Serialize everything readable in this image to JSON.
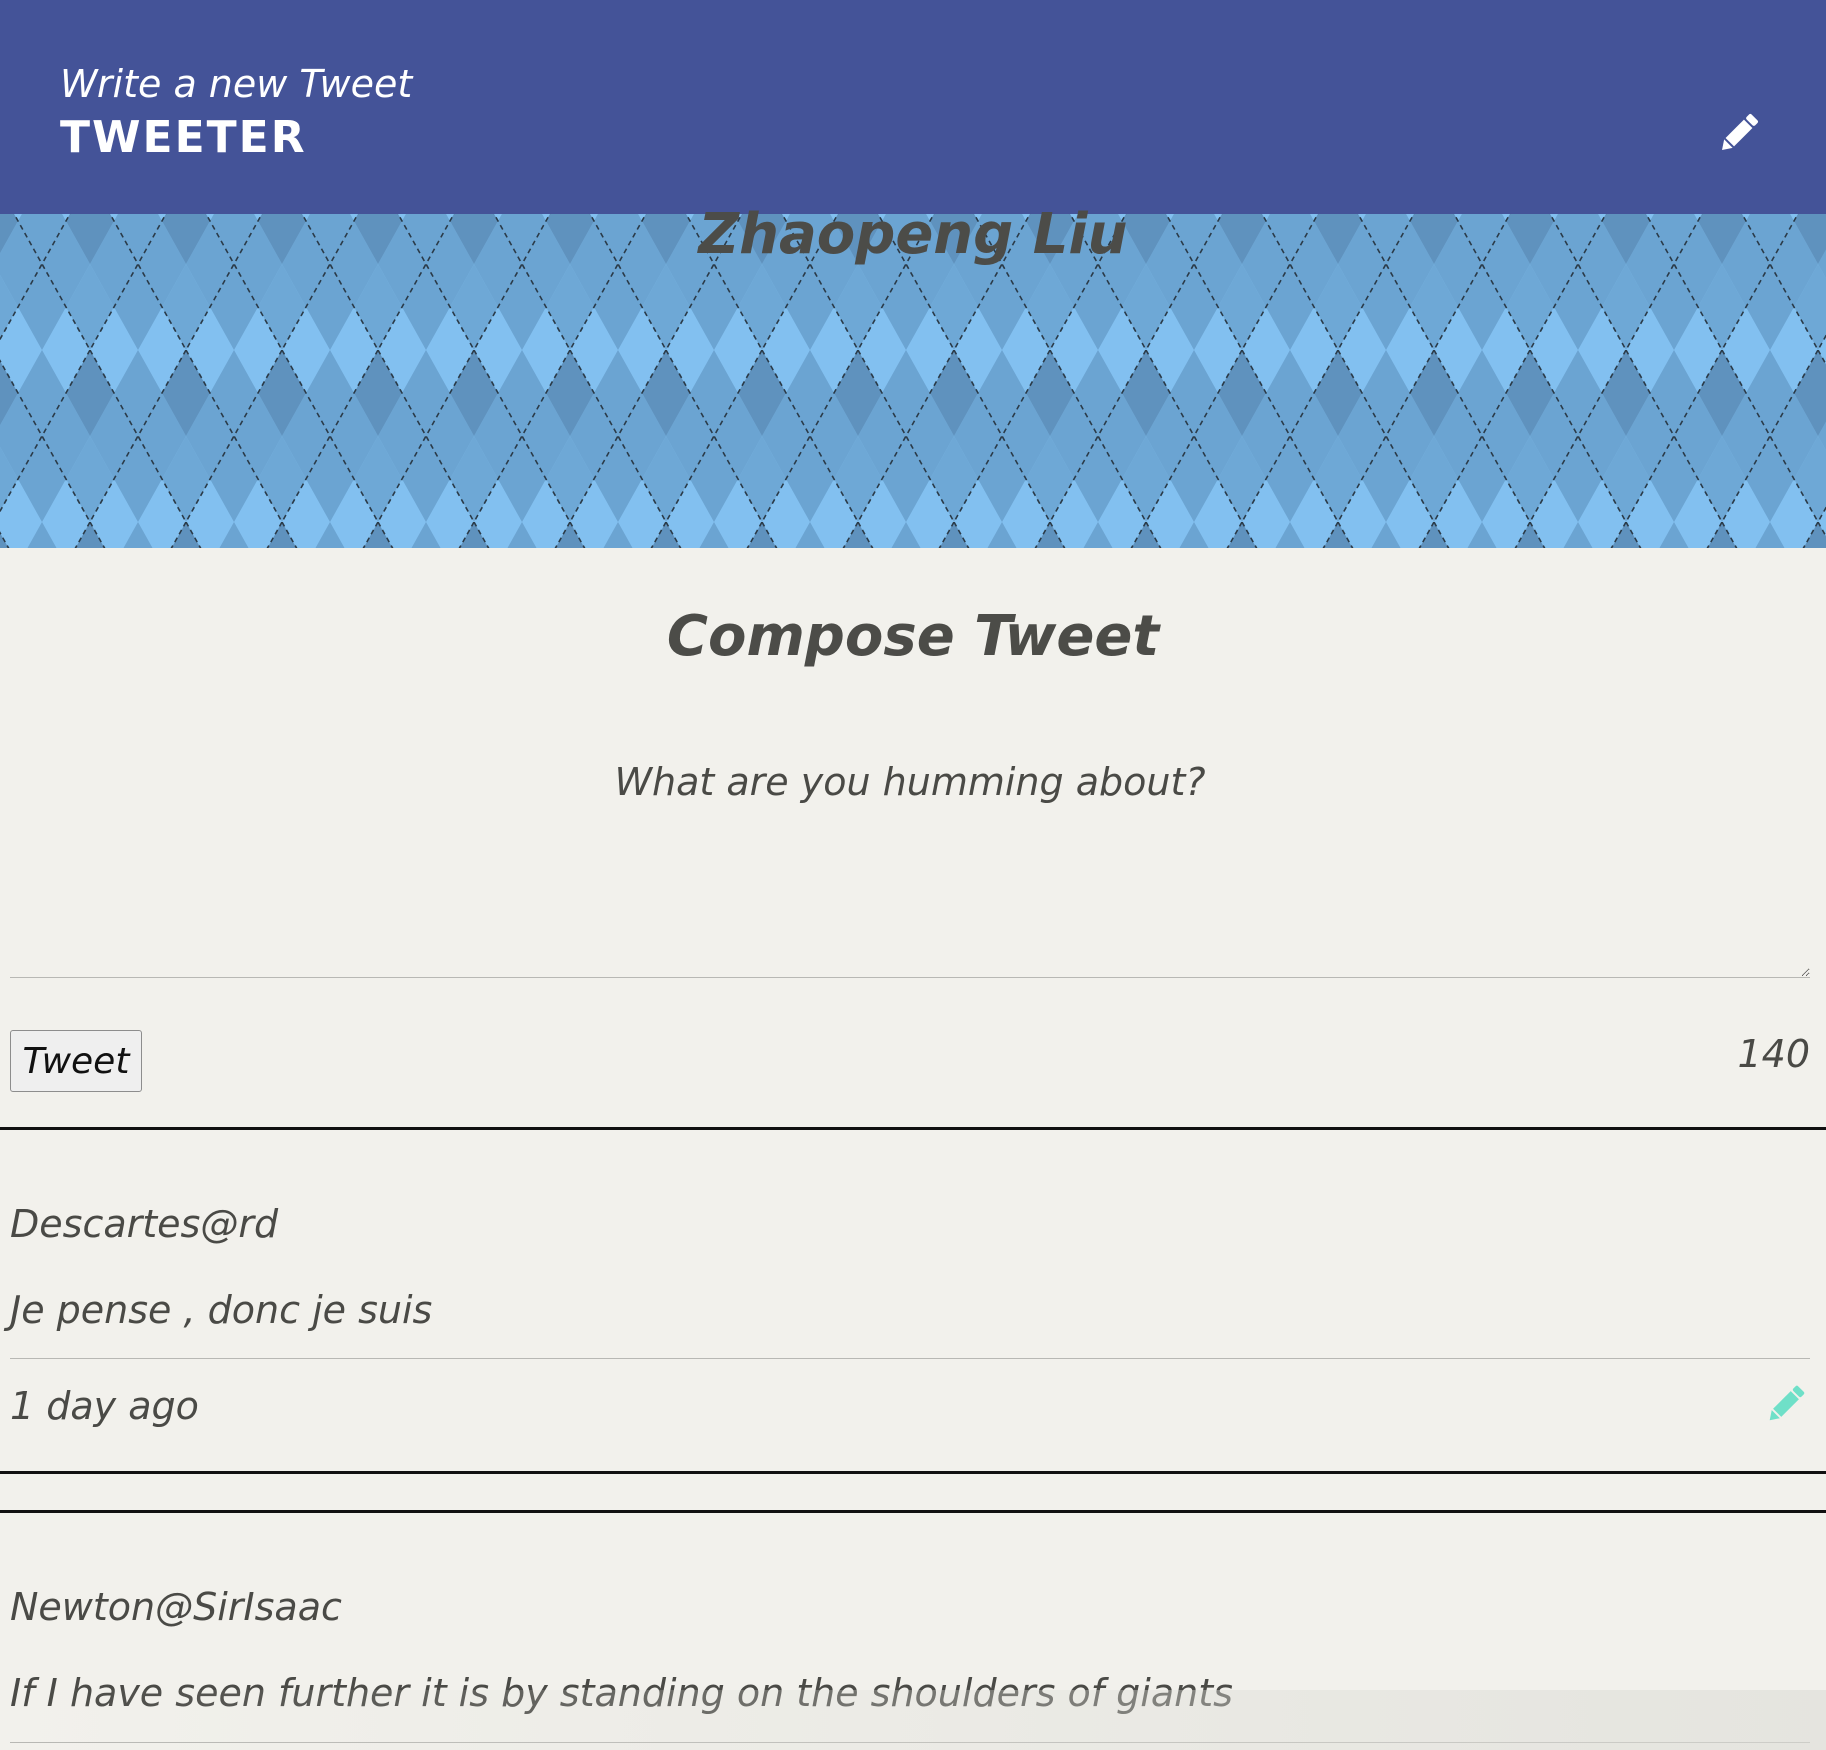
{
  "header": {
    "subtitle": "Write a new Tweet",
    "brand": "TWEETER",
    "compose_icon": "pencil-icon",
    "background_color": "#445398"
  },
  "profile": {
    "name": "Zhaopeng Liu",
    "banner_pattern": "argyle",
    "banner_colors": [
      "#82c0f0",
      "#6da8d6",
      "#5f93bf"
    ]
  },
  "compose": {
    "title": "Compose Tweet",
    "placeholder": "What are you humming about?",
    "value": "",
    "button_label": "Tweet",
    "counter": "140"
  },
  "tweets": [
    {
      "author": "Descartes@rd",
      "content": "Je pense , donc je suis",
      "time": "1 day ago",
      "action_icon": "pencil-icon",
      "action_color": "#6fe0c8"
    },
    {
      "author": "Newton@SirIsaac",
      "content": "If I have seen further it is by standing on the shoulders of giants"
    }
  ]
}
